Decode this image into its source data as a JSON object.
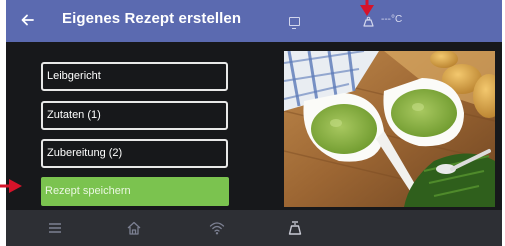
{
  "header": {
    "title": "Eigenes Rezept erstellen",
    "temperature": "---°C"
  },
  "recipe": {
    "name_button": "Leibgericht",
    "ingredients_button": "Zutaten (1)",
    "preparation_button": "Zubereitung (2)",
    "save_button": "Rezept speichern"
  },
  "icons": {
    "back": "arrow-left-icon",
    "tablet": "tablet-icon",
    "scale": "scale-icon",
    "menu": "menu-icon",
    "home": "home-icon",
    "wifi": "wifi-icon",
    "weight": "weight-icon"
  },
  "colors": {
    "header": "#5b6ab0",
    "save": "#7bc34f",
    "annotation_arrow": "#d6132a"
  }
}
